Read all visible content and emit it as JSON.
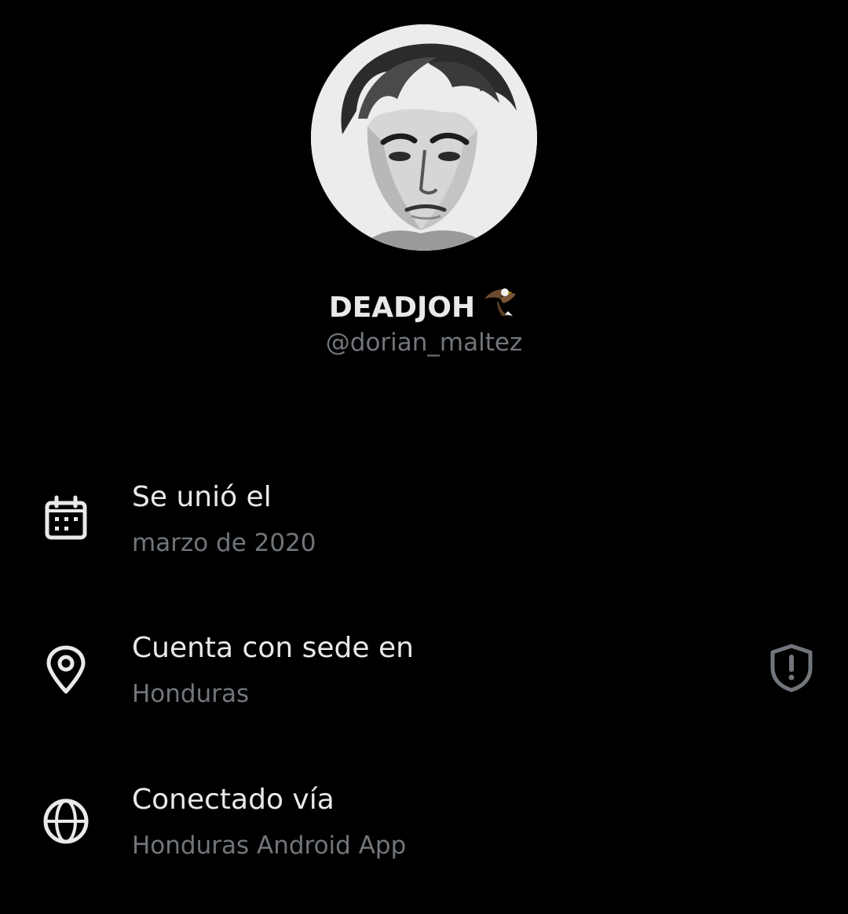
{
  "profile": {
    "display_name": "DEADJOH",
    "name_emoji": "eagle-emoji",
    "handle": "@dorian_maltez",
    "avatar": "sketch-portrait-avatar"
  },
  "info": {
    "joined": {
      "title": "Se unió el",
      "value": "marzo de 2020",
      "icon": "calendar-icon"
    },
    "location": {
      "title": "Cuenta con sede en",
      "value": "Honduras",
      "icon": "location-pin-icon",
      "action_icon": "shield-alert-icon"
    },
    "connected": {
      "title": "Conectado vía",
      "value": "Honduras Android App",
      "icon": "globe-icon"
    }
  },
  "colors": {
    "background": "#000000",
    "primary_text": "#e7e9ea",
    "secondary_text": "#71767b"
  }
}
